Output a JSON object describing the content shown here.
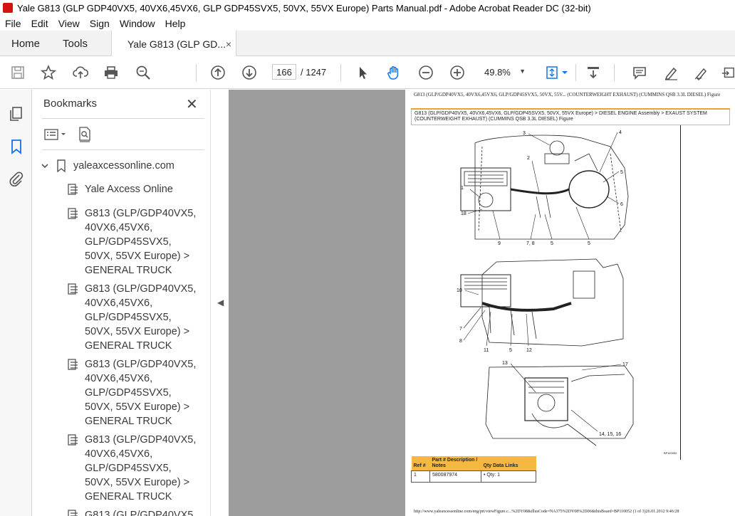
{
  "window": {
    "title": "Yale G813 (GLP GDP40VX5, 40VX6,45VX6, GLP GDP45SVX5, 50VX, 55VX Europe) Parts Manual.pdf - Adobe Acrobat Reader DC (32-bit)"
  },
  "menu": [
    "File",
    "Edit",
    "View",
    "Sign",
    "Window",
    "Help"
  ],
  "tabs": {
    "home": "Home",
    "tools": "Tools",
    "doc": "Yale G813 (GLP GD...",
    "close": "×"
  },
  "toolbar": {
    "page_current": "166",
    "page_total": "/ 1247",
    "zoom": "49.8%",
    "zoom_caret": "▼"
  },
  "bookmarks": {
    "title": "Bookmarks",
    "close": "✕",
    "root": "yaleaxcessonline.com",
    "items": [
      "Yale Axcess Online",
      "G813 (GLP/GDP40VX5, 40VX6,45VX6, GLP/GDP45SVX5, 50VX, 55VX Europe) > GENERAL TRUCK",
      "G813 (GLP/GDP40VX5, 40VX6,45VX6, GLP/GDP45SVX5, 50VX, 55VX Europe) > GENERAL TRUCK",
      "G813 (GLP/GDP40VX5, 40VX6,45VX6, GLP/GDP45SVX5, 50VX, 55VX Europe) > GENERAL TRUCK",
      "G813 (GLP/GDP40VX5, 40VX6,45VX6, GLP/GDP45SVX5, 50VX, 55VX Europe) > GENERAL TRUCK",
      "G813 (GLP/GDP40VX5,"
    ]
  },
  "document": {
    "header": "G813 (GLP/GDP40VX5, 40VX6,45VX6, GLP/GDP45SVX5, 50VX, 55V... (COUNTERWEIGHT EXHAUST) (CUMMINS QSB 3.3L DIESEL) Figure",
    "breadcrumb": "G813 (GLP/GDP40VX5, 40VX6,45VX6, GLP/GDP45SVX5, 50VX, 55VX Europe) > DIESEL ENGINE Assembly > EXAUST SYSTEM (COUNTERWEIGHT EXHAUST) (CUMMINS QSB 3.3L DIESEL) Figure",
    "callouts": [
      "1",
      "2",
      "3",
      "4",
      "5",
      "6",
      "18",
      "9",
      "7, 8",
      "5",
      "5",
      "10",
      "7",
      "8",
      "11",
      "5",
      "12",
      "13",
      "17",
      "14, 15, 16"
    ],
    "figure_id": "BP110052",
    "table_headers": [
      "Ref #",
      "Part # Description / Notes",
      "Qty Data Links"
    ],
    "table_row": [
      "1",
      "580087974",
      "• Qty: 1"
    ],
    "footer": "http://www.yaleaxcessonline.com/eng/prt/viewFigure.c...%2DY08&illusCode=NA375%2DY08%2D06&thisBoard=BP110052 (1 of 3)26.01.2012 9:46:28"
  }
}
